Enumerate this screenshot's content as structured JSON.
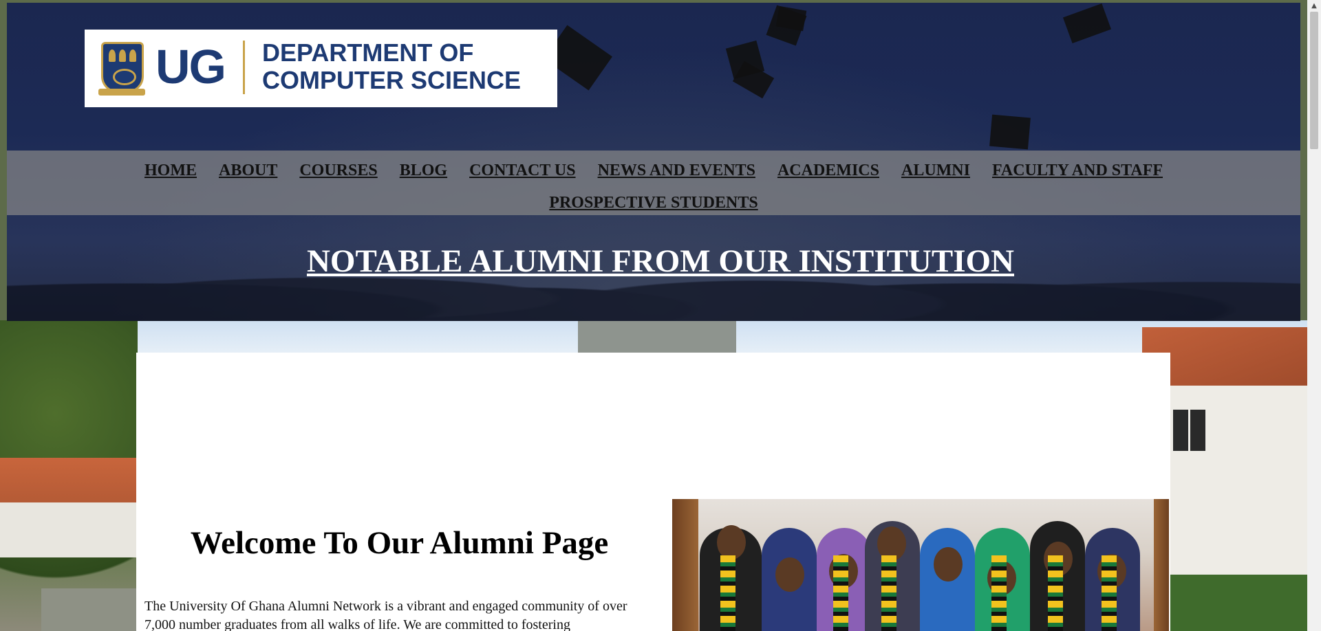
{
  "logo": {
    "initials": "UG",
    "department_line1": "DEPARTMENT OF",
    "department_line2": "COMPUTER SCIENCE"
  },
  "nav": {
    "items": [
      {
        "label": "HOME"
      },
      {
        "label": "ABOUT"
      },
      {
        "label": "COURSES"
      },
      {
        "label": "BLOG"
      },
      {
        "label": "CONTACT US"
      },
      {
        "label": "NEWS AND EVENTS"
      },
      {
        "label": "ACADEMICS"
      },
      {
        "label": "ALUMNI"
      },
      {
        "label": "FACULTY AND STAFF"
      },
      {
        "label": "PROSPECTIVE STUDENTS"
      }
    ]
  },
  "hero": {
    "title": "NOTABLE ALUMNI FROM OUR INSTITUTION"
  },
  "main": {
    "heading": "Welcome To Our Alumni Page",
    "intro": "The University Of Ghana Alumni Network is a vibrant and engaged community of over 7,000 number graduates from all walks of life. We are committed to fostering"
  },
  "colors": {
    "brand_navy": "#1d3a73",
    "brand_gold": "#c9a34a",
    "nav_band": "#878787"
  },
  "icons": {
    "scroll_up": "▲"
  }
}
